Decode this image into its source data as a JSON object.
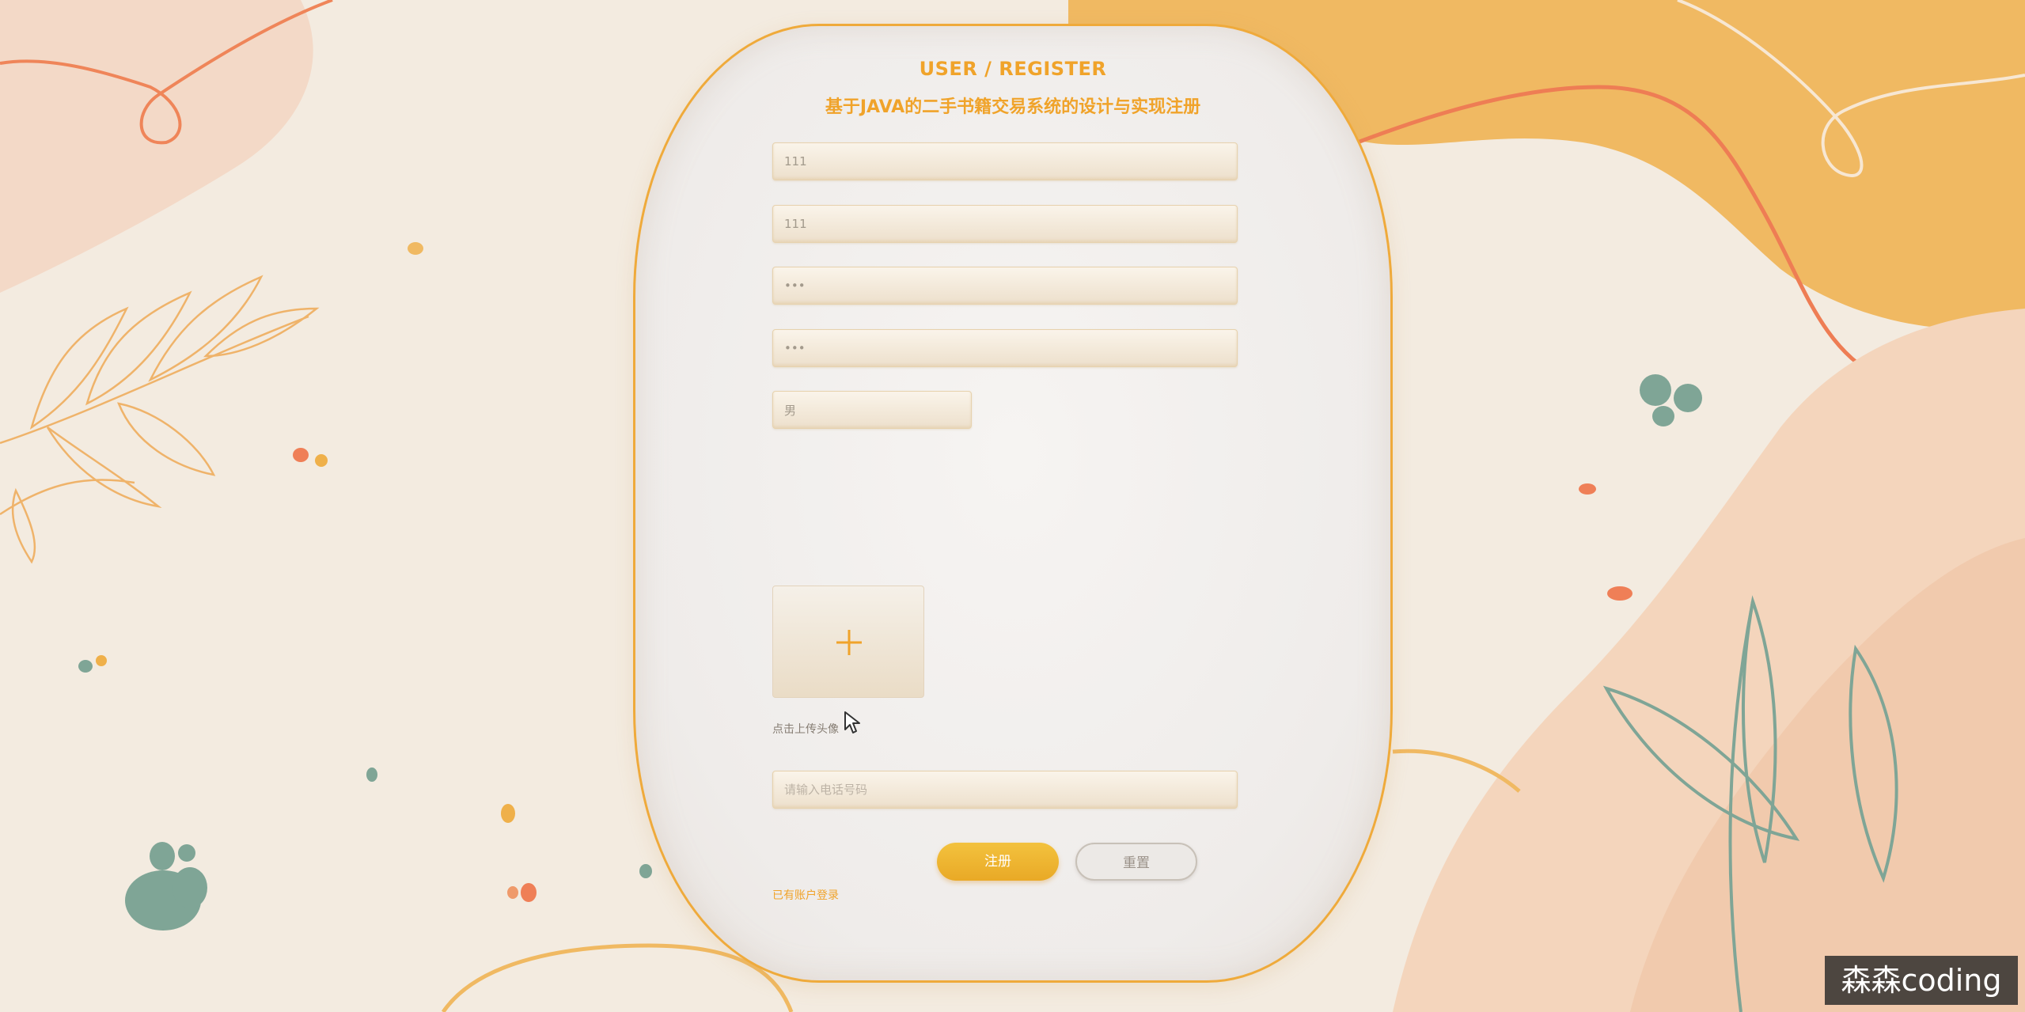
{
  "header": {
    "title": "USER / REGISTER",
    "subtitle": "基于JAVA的二手书籍交易系统的设计与实现注册"
  },
  "form": {
    "account_value": "111",
    "name_value": "111",
    "password_value": "•••",
    "confirm_password_value": "•••",
    "gender_value": "男",
    "avatar_upload_label": "点击上传头像",
    "phone_placeholder": "请输入电话号码"
  },
  "buttons": {
    "register": "注册",
    "reset": "重置"
  },
  "links": {
    "login": "已有账户登录"
  },
  "watermark": "森森coding",
  "colors": {
    "accent": "#f0a32a",
    "register_button": "#efb533",
    "background": "#f3ebe0"
  },
  "icons": {
    "avatar_upload": "plus-icon"
  }
}
